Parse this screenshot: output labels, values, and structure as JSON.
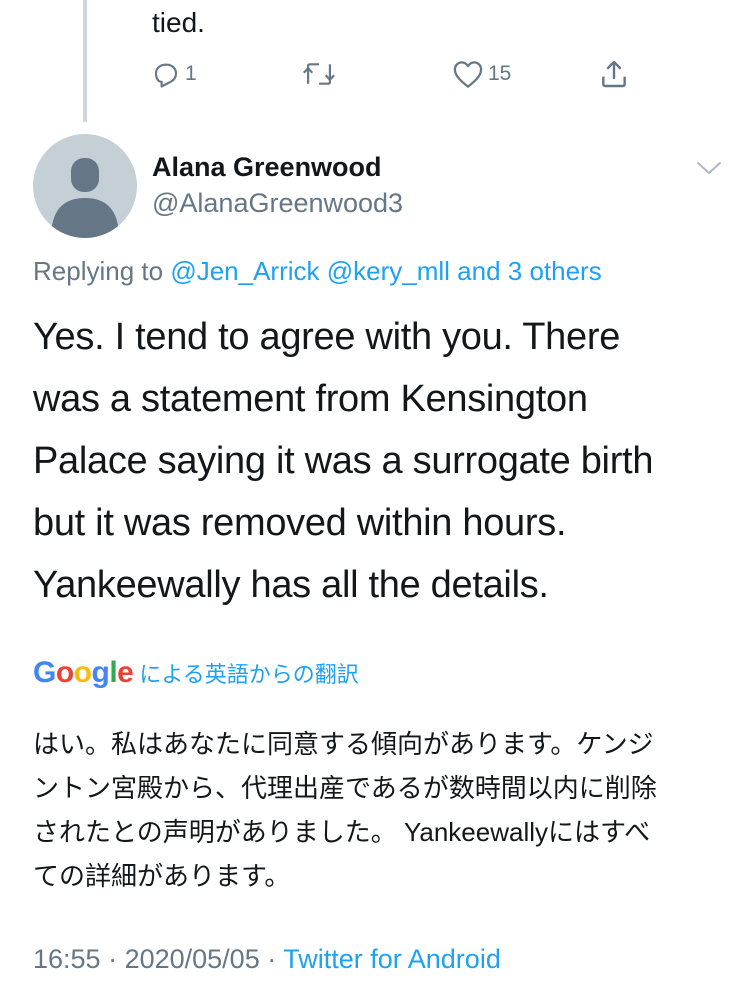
{
  "previous_tweet": {
    "text_tail": "tied.",
    "actions": {
      "reply_count": "1",
      "retweet_count": "",
      "like_count": "15"
    }
  },
  "tweet": {
    "author_name": "Alana Greenwood",
    "author_handle": "@AlanaGreenwood3",
    "replying_prefix": "Replying to ",
    "replying_mentions": "@Jen_Arrick @kery_mll and 3 others",
    "body_lines": [
      "Yes. I tend to agree with you. There",
      "was a statement from Kensington",
      "Palace saying it was a surrogate birth",
      "but it was removed within hours.",
      "Yankeewally has all the details."
    ],
    "translation_label": "による英語からの翻訳",
    "translation_lines": [
      "はい。私はあなたに同意する傾向があります。ケンジ",
      "ントン宮殿から、代理出産であるが数時間以内に削除",
      "されたとの声明がありました。 Yankeewallyにはすべ",
      "ての詳細があります。"
    ],
    "time": "16:55",
    "date": "2020/05/05",
    "separator": " · ",
    "source": "Twitter for Android"
  },
  "google_logo": {
    "letters": [
      "G",
      "o",
      "o",
      "g",
      "l",
      "e"
    ],
    "colors": [
      "#4285F4",
      "#EA4335",
      "#FBBC05",
      "#4285F4",
      "#34A853",
      "#EA4335"
    ]
  },
  "icons": [
    "reply-icon",
    "retweet-icon",
    "like-icon",
    "share-icon",
    "chevron-down-icon",
    "default-avatar-icon"
  ],
  "colors": {
    "text": "#14171a",
    "secondary": "#657786",
    "link": "#1da1f2",
    "thread_line": "#ccd6dd",
    "avatar_bg": "#c4cfd6"
  }
}
